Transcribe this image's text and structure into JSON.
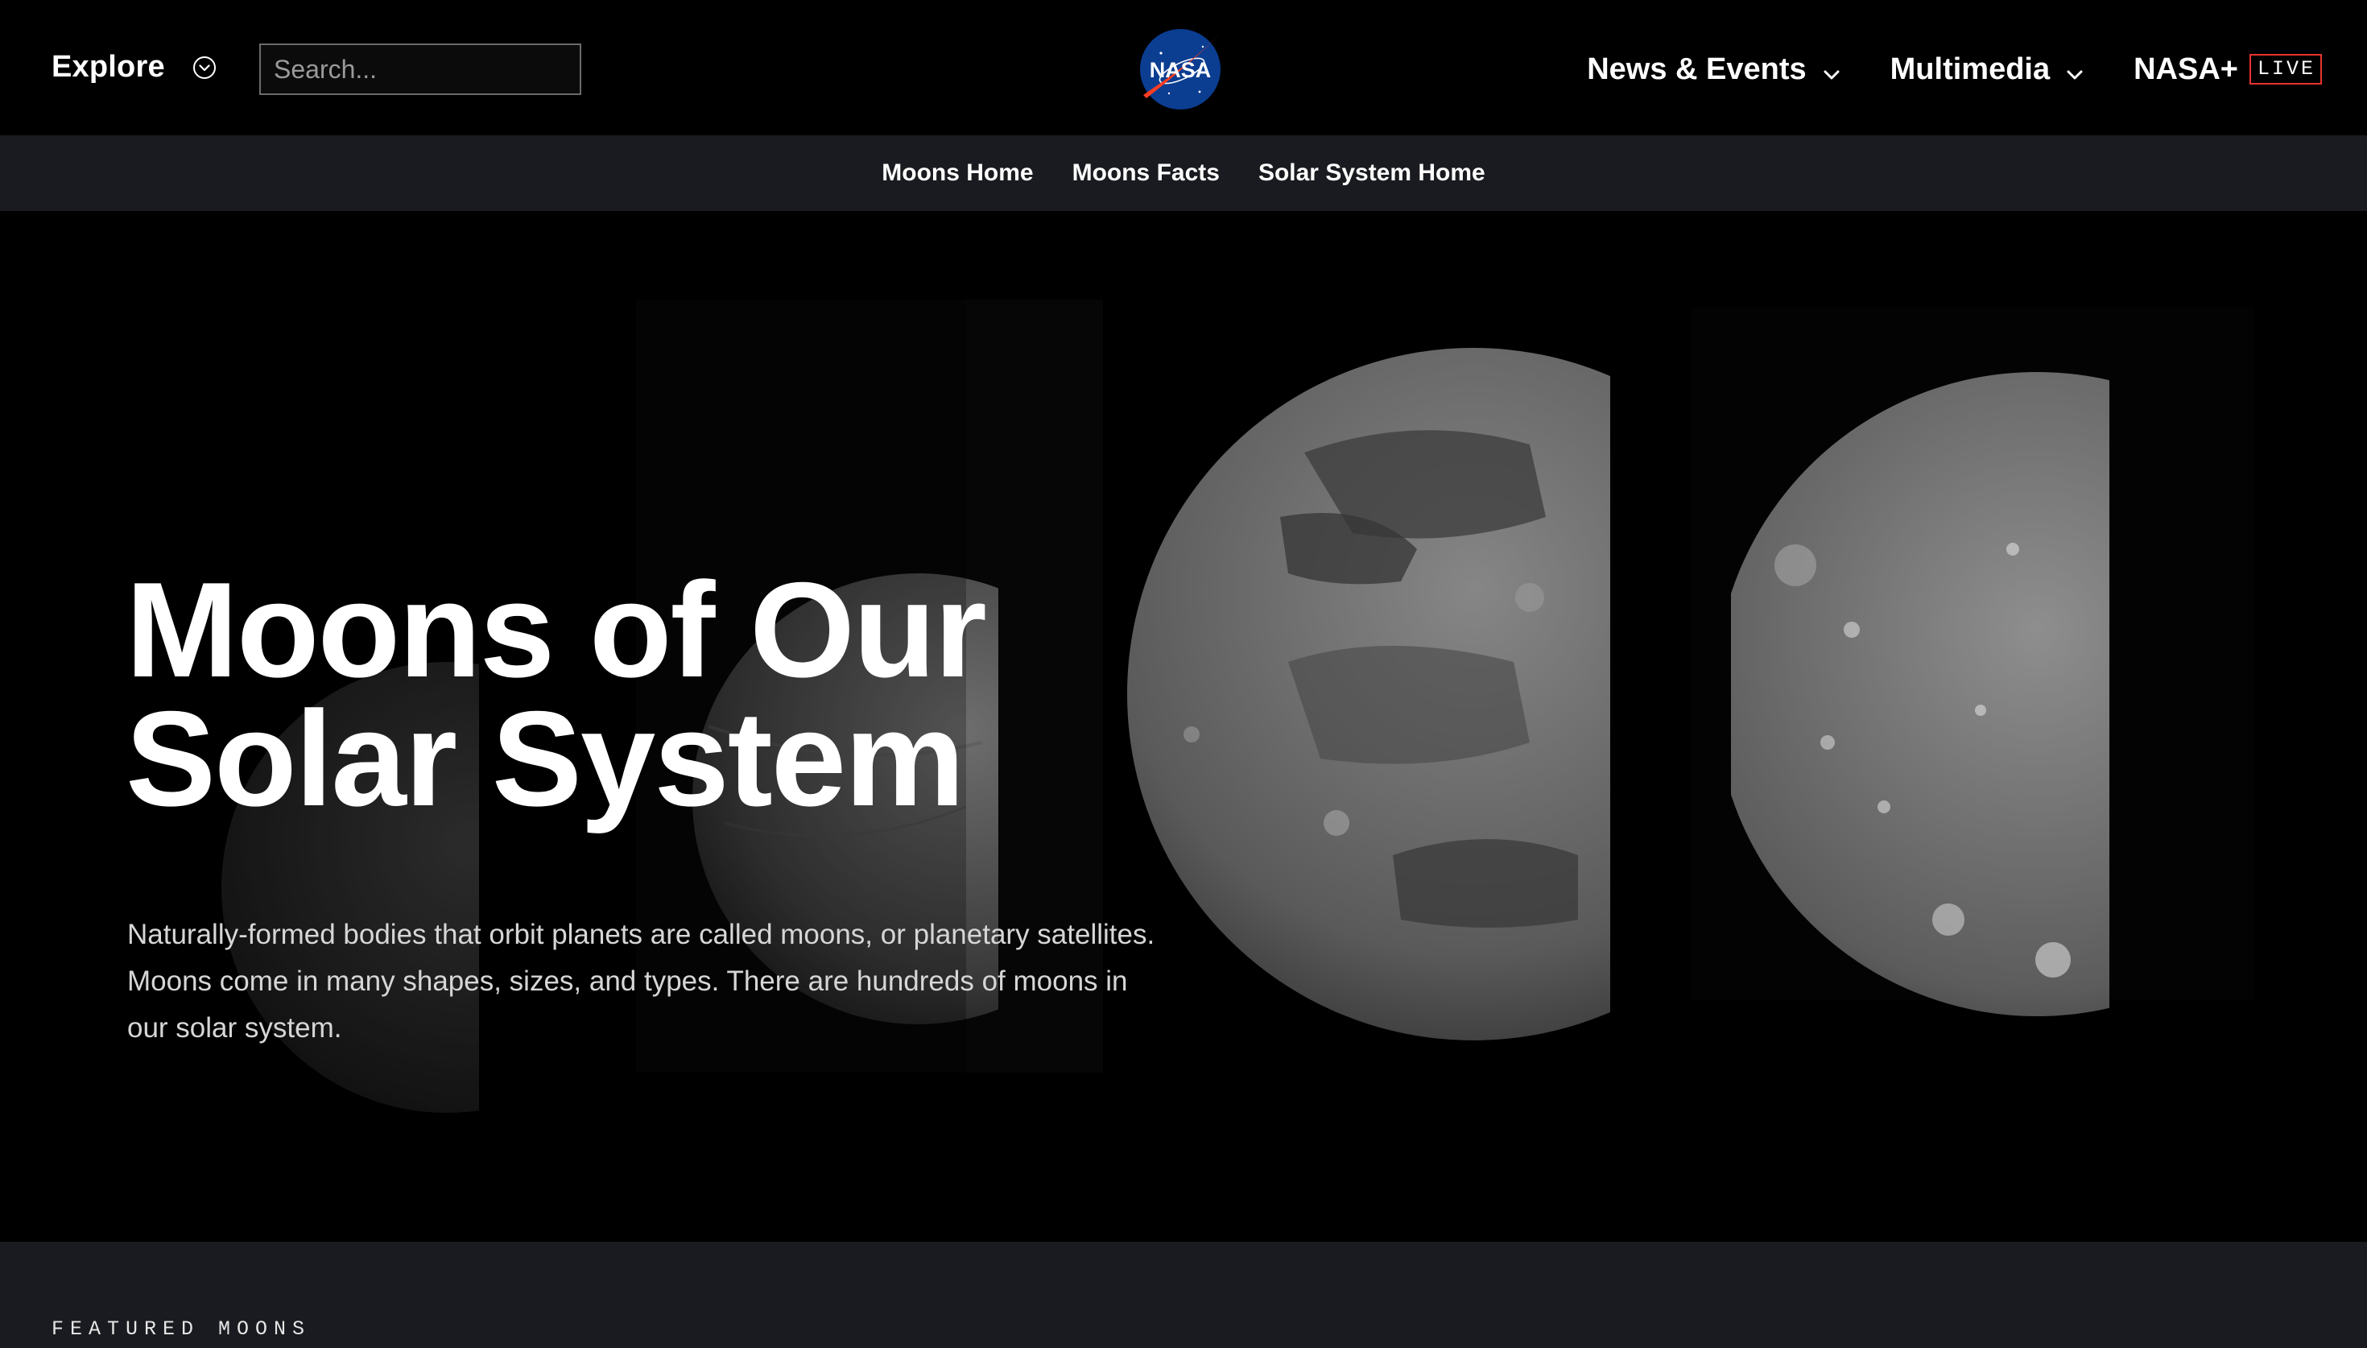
{
  "header": {
    "explore_label": "Explore",
    "search_placeholder": "Search...",
    "logo_text": "NASA",
    "nav": [
      {
        "label": "News & Events",
        "icon": "chevron-down-icon"
      },
      {
        "label": "Multimedia",
        "icon": "chevron-down-icon"
      },
      {
        "label": "NASA+",
        "badge": "LIVE"
      }
    ]
  },
  "subnav": {
    "items": [
      {
        "label": "Moons Home"
      },
      {
        "label": "Moons Facts"
      },
      {
        "label": "Solar System Home"
      }
    ]
  },
  "hero": {
    "title_line1": "Moons of Our",
    "title_line2": "Solar System",
    "description": "Naturally-formed bodies that orbit planets are called moons, or planetary satellites. Moons come in many shapes, sizes, and types. There are hundreds of moons in our solar system."
  },
  "featured": {
    "label": "FEATURED MOONS"
  },
  "colors": {
    "background": "#000000",
    "subnav_bg": "#1a1b20",
    "live_badge_border": "#e8332f",
    "nasa_blue": "#0b3d91",
    "nasa_red": "#fc3d21"
  }
}
